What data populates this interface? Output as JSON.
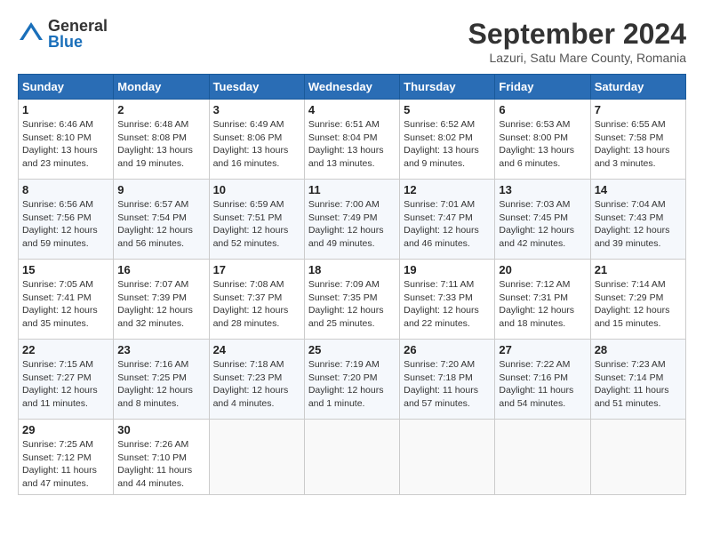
{
  "logo": {
    "general": "General",
    "blue": "Blue"
  },
  "title": "September 2024",
  "subtitle": "Lazuri, Satu Mare County, Romania",
  "headers": [
    "Sunday",
    "Monday",
    "Tuesday",
    "Wednesday",
    "Thursday",
    "Friday",
    "Saturday"
  ],
  "weeks": [
    [
      {
        "day": "1",
        "info": "Sunrise: 6:46 AM\nSunset: 8:10 PM\nDaylight: 13 hours\nand 23 minutes."
      },
      {
        "day": "2",
        "info": "Sunrise: 6:48 AM\nSunset: 8:08 PM\nDaylight: 13 hours\nand 19 minutes."
      },
      {
        "day": "3",
        "info": "Sunrise: 6:49 AM\nSunset: 8:06 PM\nDaylight: 13 hours\nand 16 minutes."
      },
      {
        "day": "4",
        "info": "Sunrise: 6:51 AM\nSunset: 8:04 PM\nDaylight: 13 hours\nand 13 minutes."
      },
      {
        "day": "5",
        "info": "Sunrise: 6:52 AM\nSunset: 8:02 PM\nDaylight: 13 hours\nand 9 minutes."
      },
      {
        "day": "6",
        "info": "Sunrise: 6:53 AM\nSunset: 8:00 PM\nDaylight: 13 hours\nand 6 minutes."
      },
      {
        "day": "7",
        "info": "Sunrise: 6:55 AM\nSunset: 7:58 PM\nDaylight: 13 hours\nand 3 minutes."
      }
    ],
    [
      {
        "day": "8",
        "info": "Sunrise: 6:56 AM\nSunset: 7:56 PM\nDaylight: 12 hours\nand 59 minutes."
      },
      {
        "day": "9",
        "info": "Sunrise: 6:57 AM\nSunset: 7:54 PM\nDaylight: 12 hours\nand 56 minutes."
      },
      {
        "day": "10",
        "info": "Sunrise: 6:59 AM\nSunset: 7:51 PM\nDaylight: 12 hours\nand 52 minutes."
      },
      {
        "day": "11",
        "info": "Sunrise: 7:00 AM\nSunset: 7:49 PM\nDaylight: 12 hours\nand 49 minutes."
      },
      {
        "day": "12",
        "info": "Sunrise: 7:01 AM\nSunset: 7:47 PM\nDaylight: 12 hours\nand 46 minutes."
      },
      {
        "day": "13",
        "info": "Sunrise: 7:03 AM\nSunset: 7:45 PM\nDaylight: 12 hours\nand 42 minutes."
      },
      {
        "day": "14",
        "info": "Sunrise: 7:04 AM\nSunset: 7:43 PM\nDaylight: 12 hours\nand 39 minutes."
      }
    ],
    [
      {
        "day": "15",
        "info": "Sunrise: 7:05 AM\nSunset: 7:41 PM\nDaylight: 12 hours\nand 35 minutes."
      },
      {
        "day": "16",
        "info": "Sunrise: 7:07 AM\nSunset: 7:39 PM\nDaylight: 12 hours\nand 32 minutes."
      },
      {
        "day": "17",
        "info": "Sunrise: 7:08 AM\nSunset: 7:37 PM\nDaylight: 12 hours\nand 28 minutes."
      },
      {
        "day": "18",
        "info": "Sunrise: 7:09 AM\nSunset: 7:35 PM\nDaylight: 12 hours\nand 25 minutes."
      },
      {
        "day": "19",
        "info": "Sunrise: 7:11 AM\nSunset: 7:33 PM\nDaylight: 12 hours\nand 22 minutes."
      },
      {
        "day": "20",
        "info": "Sunrise: 7:12 AM\nSunset: 7:31 PM\nDaylight: 12 hours\nand 18 minutes."
      },
      {
        "day": "21",
        "info": "Sunrise: 7:14 AM\nSunset: 7:29 PM\nDaylight: 12 hours\nand 15 minutes."
      }
    ],
    [
      {
        "day": "22",
        "info": "Sunrise: 7:15 AM\nSunset: 7:27 PM\nDaylight: 12 hours\nand 11 minutes."
      },
      {
        "day": "23",
        "info": "Sunrise: 7:16 AM\nSunset: 7:25 PM\nDaylight: 12 hours\nand 8 minutes."
      },
      {
        "day": "24",
        "info": "Sunrise: 7:18 AM\nSunset: 7:23 PM\nDaylight: 12 hours\nand 4 minutes."
      },
      {
        "day": "25",
        "info": "Sunrise: 7:19 AM\nSunset: 7:20 PM\nDaylight: 12 hours\nand 1 minute."
      },
      {
        "day": "26",
        "info": "Sunrise: 7:20 AM\nSunset: 7:18 PM\nDaylight: 11 hours\nand 57 minutes."
      },
      {
        "day": "27",
        "info": "Sunrise: 7:22 AM\nSunset: 7:16 PM\nDaylight: 11 hours\nand 54 minutes."
      },
      {
        "day": "28",
        "info": "Sunrise: 7:23 AM\nSunset: 7:14 PM\nDaylight: 11 hours\nand 51 minutes."
      }
    ],
    [
      {
        "day": "29",
        "info": "Sunrise: 7:25 AM\nSunset: 7:12 PM\nDaylight: 11 hours\nand 47 minutes."
      },
      {
        "day": "30",
        "info": "Sunrise: 7:26 AM\nSunset: 7:10 PM\nDaylight: 11 hours\nand 44 minutes."
      },
      null,
      null,
      null,
      null,
      null
    ]
  ]
}
